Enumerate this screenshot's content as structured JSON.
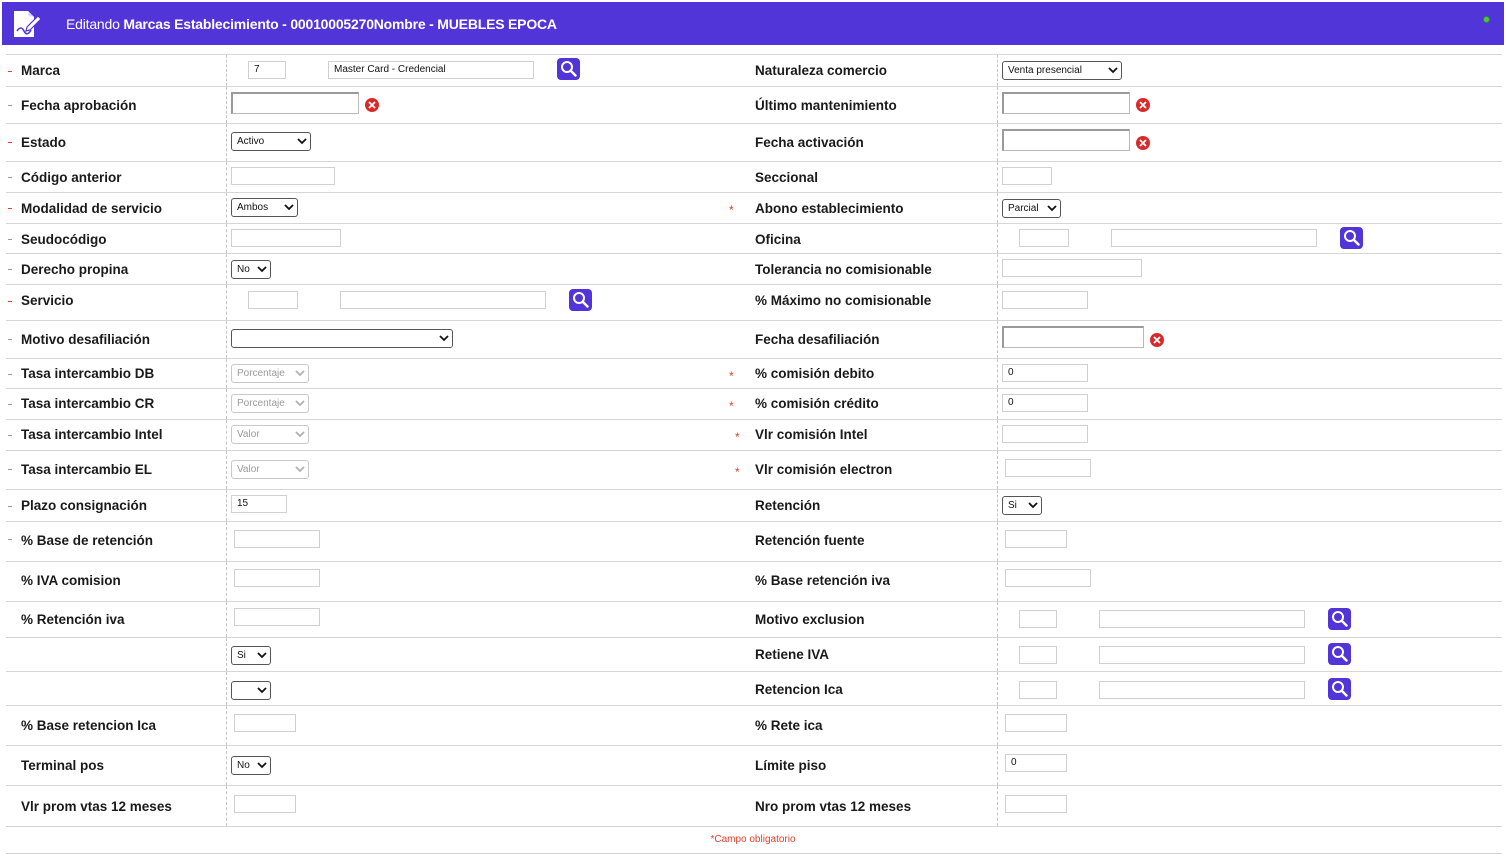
{
  "header": {
    "prefix": "Editando",
    "entity": "Marcas Establecimiento - 00010005270Nombre - MUEBLES EPOCA"
  },
  "rows": [
    {
      "left": {
        "label": "Marca",
        "code": "7",
        "name": "Master Card - Credencial"
      },
      "right": {
        "label": "Naturaleza comercio",
        "value": "Venta presencial"
      }
    },
    {
      "left": {
        "label": "Fecha aprobación",
        "value": ""
      },
      "right": {
        "label": "Último mantenimiento",
        "value": ""
      }
    },
    {
      "left": {
        "label": "Estado",
        "value": "Activo"
      },
      "right": {
        "label": "Fecha activación",
        "value": ""
      }
    },
    {
      "left": {
        "label": "Código anterior",
        "value": ""
      },
      "right": {
        "label": "Seccional",
        "value": ""
      }
    },
    {
      "left": {
        "label": "Modalidad de servicio",
        "value": "Ambos"
      },
      "right": {
        "label": "Abono establecimiento",
        "value": "Parcial"
      }
    },
    {
      "left": {
        "label": "Seudocódigo",
        "value": ""
      },
      "right": {
        "label": "Oficina",
        "code": "",
        "name": ""
      }
    },
    {
      "left": {
        "label": "Derecho propina",
        "value": "No"
      },
      "right": {
        "label": "Tolerancia no comisionable",
        "value": ""
      }
    },
    {
      "left": {
        "label": "Servicio",
        "code": "",
        "name": ""
      },
      "right": {
        "label": "% Máximo no comisionable",
        "value": ""
      }
    },
    {
      "left": {
        "label": "Motivo desafiliación",
        "value": ""
      },
      "right": {
        "label": "Fecha desafiliación",
        "value": ""
      }
    },
    {
      "left": {
        "label": "Tasa intercambio DB",
        "value": "Porcentaje"
      },
      "right": {
        "label": "% comisión debito",
        "value": "0"
      }
    },
    {
      "left": {
        "label": "Tasa intercambio CR",
        "value": "Porcentaje"
      },
      "right": {
        "label": "% comisión crédito",
        "value": "0"
      }
    },
    {
      "left": {
        "label": "Tasa intercambio Intel",
        "value": "Valor"
      },
      "right": {
        "label": "Vlr comisión Intel",
        "value": ""
      }
    },
    {
      "left": {
        "label": "Tasa intercambio EL",
        "value": "Valor"
      },
      "right": {
        "label": "Vlr comisión electron",
        "value": ""
      }
    },
    {
      "left": {
        "label": "Plazo consignación",
        "value": "15"
      },
      "right": {
        "label": "Retención",
        "value": "Si"
      }
    },
    {
      "left": {
        "label": "% Base de retención",
        "value": ""
      },
      "right": {
        "label": "Retención fuente",
        "value": ""
      }
    },
    {
      "left": {
        "label": "% IVA comision",
        "value": ""
      },
      "right": {
        "label": "% Base retención iva",
        "value": ""
      }
    },
    {
      "left": {
        "label": "% Retención iva",
        "value": ""
      },
      "right": {
        "label": "Motivo exclusion",
        "code": "",
        "name": ""
      }
    },
    {
      "left": {
        "label": "",
        "value": "Si"
      },
      "right": {
        "label": "Retiene IVA",
        "code": "",
        "name": ""
      }
    },
    {
      "left": {
        "label": "",
        "value": ""
      },
      "right": {
        "label": "Retencion Ica",
        "code": "",
        "name": ""
      }
    },
    {
      "left": {
        "label": "% Base retencion Ica",
        "value": ""
      },
      "right": {
        "label": "% Rete ica",
        "value": ""
      }
    },
    {
      "left": {
        "label": "Terminal pos",
        "value": "No"
      },
      "right": {
        "label": "Límite piso",
        "value": "0"
      }
    },
    {
      "left": {
        "label": "Vlr prom vtas 12 meses",
        "value": ""
      },
      "right": {
        "label": "Nro prom vtas 12 meses",
        "value": ""
      }
    }
  ],
  "required_note": "*Campo obligatorio",
  "icons": {
    "header": "edit-document-icon",
    "search": "search-icon",
    "clear": "clear-x-icon",
    "dropdown": "chevron-down-icon",
    "status": "status-dot-icon"
  },
  "colors": {
    "header_bg": "#5135d8",
    "search_btn": "#5135d8",
    "clear_btn": "#d82a2a",
    "required": "#e0402a"
  }
}
